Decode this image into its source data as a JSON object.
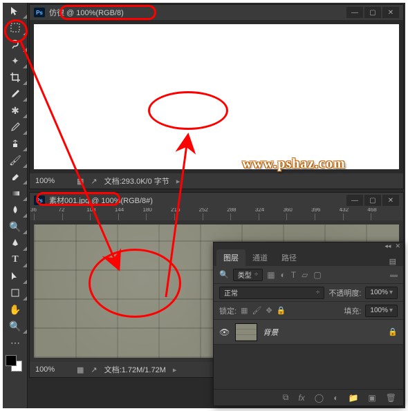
{
  "doc1": {
    "title": "仿徨 @ 100%(RGB/8)",
    "zoom": "100%",
    "status": "文档:293.0K/0 字节"
  },
  "doc2": {
    "title": "素材001.jpg @ 100%(RGB/8#)",
    "zoom": "100%",
    "status": "文档:1.72M/1.72M"
  },
  "ruler_ticks": [
    "36",
    "72",
    "108",
    "144",
    "180",
    "216",
    "252",
    "288",
    "324",
    "360",
    "396",
    "432",
    "468"
  ],
  "layers": {
    "tabs": [
      "图层",
      "通道",
      "路径"
    ],
    "filter_label": "类型",
    "blend_mode": "正常",
    "opacity_label": "不透明度:",
    "opacity_value": "100%",
    "lock_label": "锁定:",
    "fill_label": "填充:",
    "fill_value": "100%",
    "items": [
      {
        "name": "背景"
      }
    ]
  },
  "watermark": "www.pshaz.com",
  "window_buttons": {
    "min": "—",
    "max": "▢",
    "close": "✕"
  }
}
